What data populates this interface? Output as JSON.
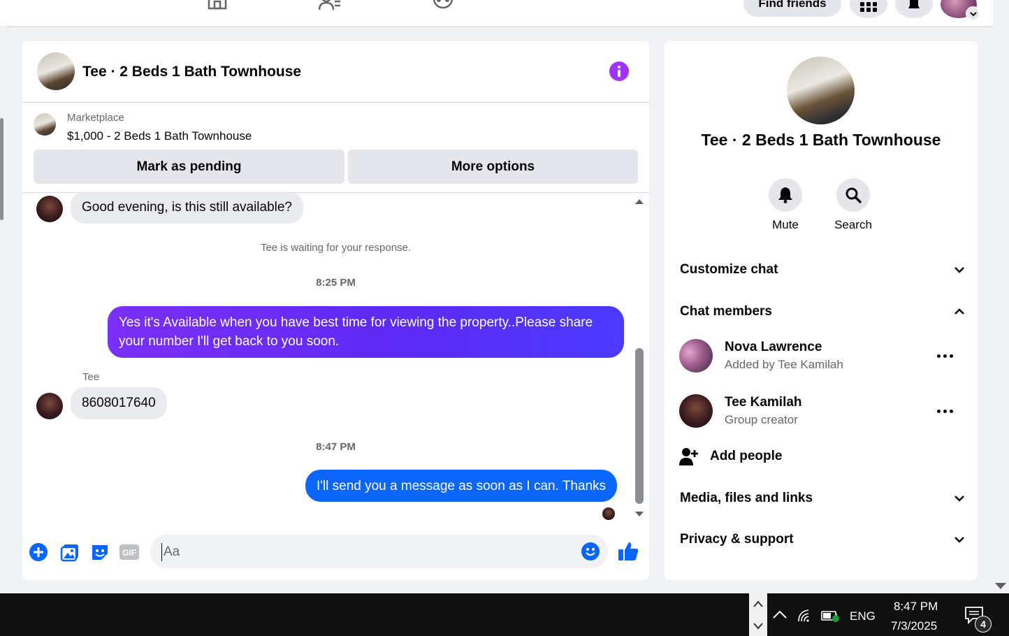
{
  "topbar": {
    "nav_icons": [
      "marketplace-icon",
      "friends-icon",
      "groups-icon"
    ],
    "find_friends_label": "Find friends",
    "menu_icon": "grid-menu-icon",
    "notifications_icon": "bell-icon"
  },
  "chat": {
    "title": "Tee · 2 Beds 1 Bath Townhouse",
    "info_icon": "info-icon",
    "info_color": "#a033ff",
    "listing": {
      "label": "Marketplace",
      "title": "$1,000 - 2 Beds 1 Bath Townhouse",
      "mark_pending_label": "Mark as pending",
      "more_options_label": "More options"
    },
    "messages": {
      "first_incoming": "Good evening, is this still available?",
      "waiting_note": "Tee is waiting for your response.",
      "time1": "8:25 PM",
      "outgoing1": "Yes it's Available when you have best time for viewing the property..Please share your number I'll get back to you soon.",
      "sender": "Tee",
      "incoming2": "8608017640",
      "time2": "8:47 PM",
      "outgoing2": "I'll send you a message as soon as I can. Thanks"
    },
    "composer": {
      "placeholder": "Aa",
      "value": "",
      "icons": [
        "plus-icon",
        "photo-icon",
        "sticker-icon",
        "gif-icon",
        "emoji-icon",
        "thumbs-up-icon"
      ]
    },
    "colors": {
      "outgoing_purple": "#7b2ff7",
      "outgoing_blue": "#0a66ff",
      "accent": "#0866ff"
    }
  },
  "panel": {
    "name": "Tee · 2 Beds 1 Bath Townhouse",
    "actions": [
      {
        "label": "Mute",
        "icon": "bell-icon"
      },
      {
        "label": "Search",
        "icon": "search-icon"
      }
    ],
    "sections": {
      "customize": "Customize chat",
      "members": "Chat members",
      "media": "Media, files and links",
      "privacy": "Privacy & support"
    },
    "members": [
      {
        "name": "Nova Lawrence",
        "sub": "Added by Tee Kamilah"
      },
      {
        "name": "Tee Kamilah",
        "sub": "Group creator"
      }
    ],
    "add_people_label": "Add people"
  },
  "taskbar": {
    "language": "ENG",
    "time": "8:47 PM",
    "date": "7/3/2025",
    "notification_count": "4"
  }
}
